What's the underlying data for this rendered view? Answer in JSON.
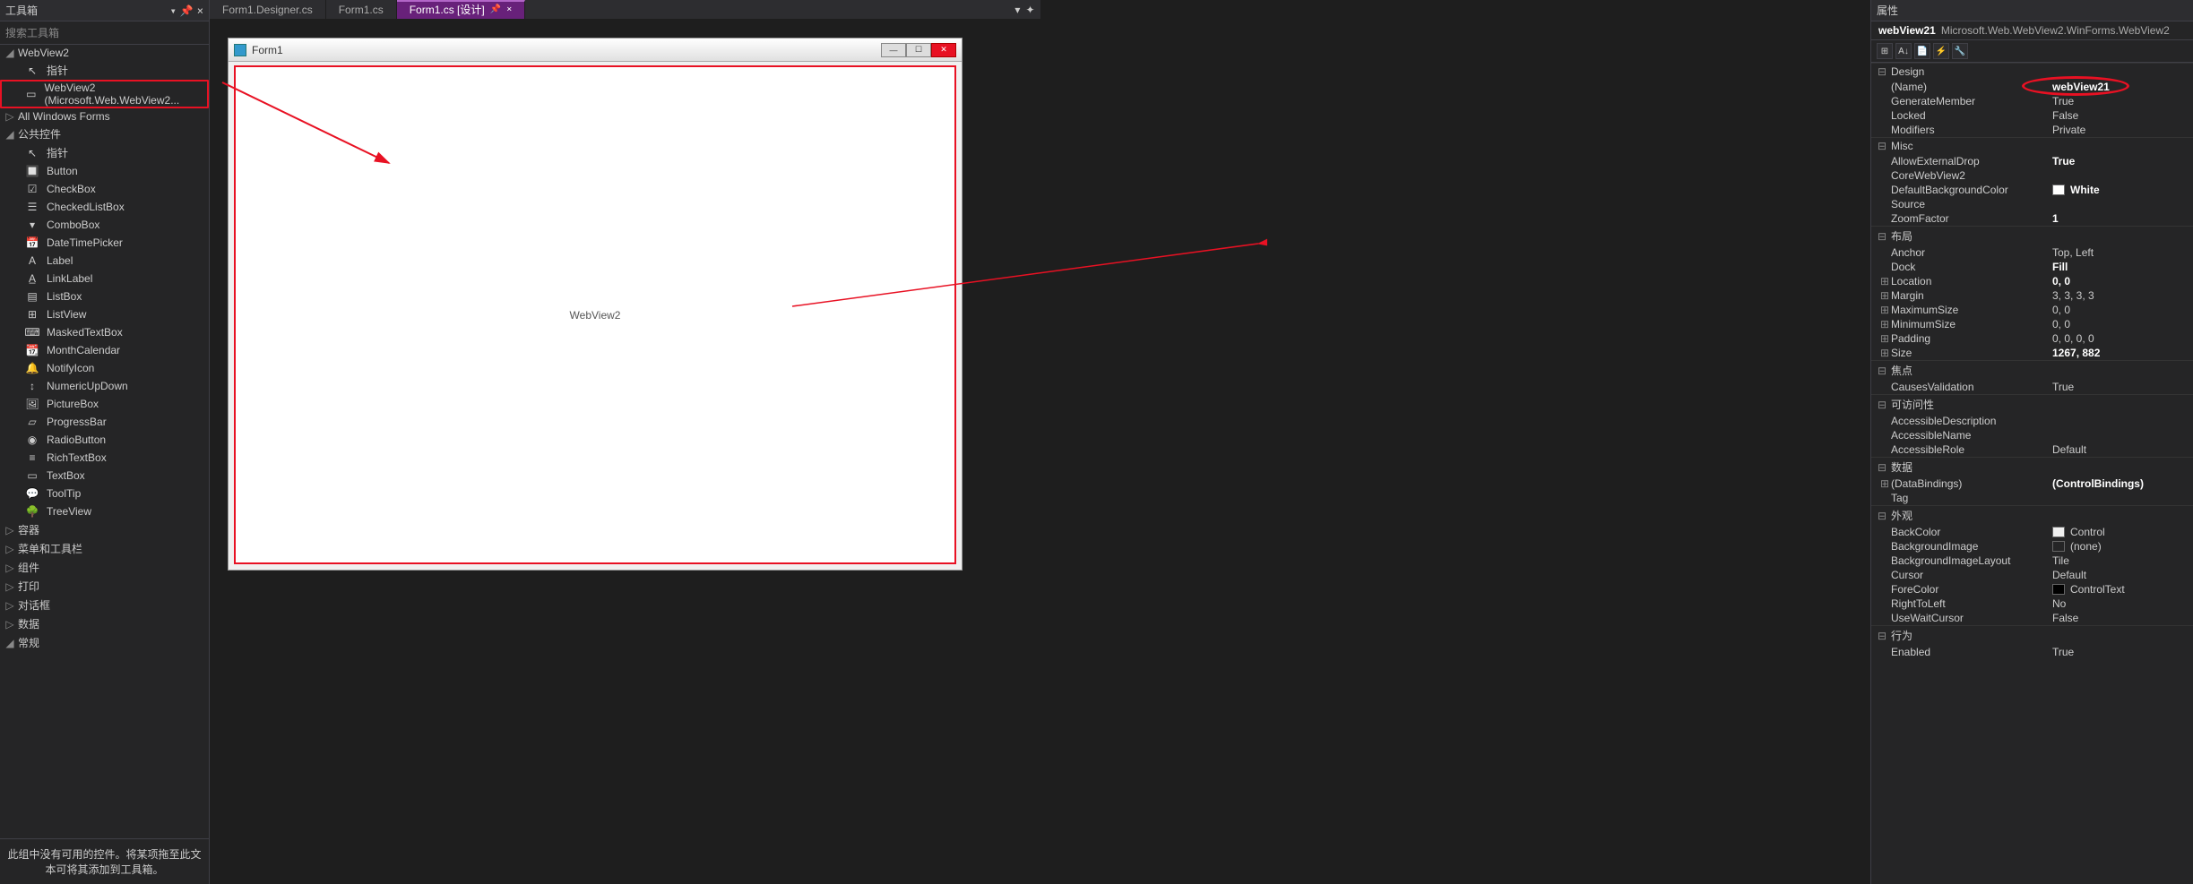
{
  "toolbox": {
    "title": "工具箱",
    "search_placeholder": "搜索工具箱",
    "groups": {
      "webview2": {
        "label": "WebView2",
        "open": true,
        "items": [
          {
            "icon": "pointer",
            "label": "指针"
          },
          {
            "icon": "webview",
            "label": "WebView2 (Microsoft.Web.WebView2...",
            "highlighted": true
          }
        ]
      },
      "allwin": {
        "label": "All Windows Forms",
        "open": false
      },
      "common": {
        "label": "公共控件",
        "open": true
      },
      "containers": {
        "label": "容器",
        "open": false
      },
      "menus": {
        "label": "菜单和工具栏",
        "open": false
      },
      "components": {
        "label": "组件",
        "open": false
      },
      "printing": {
        "label": "打印",
        "open": false
      },
      "dialogs": {
        "label": "对话框",
        "open": false
      },
      "data": {
        "label": "数据",
        "open": false
      },
      "general": {
        "label": "常规",
        "open": true
      }
    },
    "common_items": [
      {
        "icon": "pointer",
        "label": "指针"
      },
      {
        "icon": "button",
        "label": "Button"
      },
      {
        "icon": "checkbox",
        "label": "CheckBox"
      },
      {
        "icon": "clist",
        "label": "CheckedListBox"
      },
      {
        "icon": "combo",
        "label": "ComboBox"
      },
      {
        "icon": "dtp",
        "label": "DateTimePicker"
      },
      {
        "icon": "label",
        "label": "Label"
      },
      {
        "icon": "linklabel",
        "label": "LinkLabel"
      },
      {
        "icon": "listbox",
        "label": "ListBox"
      },
      {
        "icon": "listview",
        "label": "ListView"
      },
      {
        "icon": "mtext",
        "label": "MaskedTextBox"
      },
      {
        "icon": "mcal",
        "label": "MonthCalendar"
      },
      {
        "icon": "nicon",
        "label": "NotifyIcon"
      },
      {
        "icon": "nud",
        "label": "NumericUpDown"
      },
      {
        "icon": "pbox",
        "label": "PictureBox"
      },
      {
        "icon": "pbar",
        "label": "ProgressBar"
      },
      {
        "icon": "radio",
        "label": "RadioButton"
      },
      {
        "icon": "rtb",
        "label": "RichTextBox"
      },
      {
        "icon": "tbox",
        "label": "TextBox"
      },
      {
        "icon": "ttip",
        "label": "ToolTip"
      },
      {
        "icon": "tview",
        "label": "TreeView"
      }
    ],
    "footer": "此组中没有可用的控件。将某项拖至此文本可将其添加到工具箱。"
  },
  "tabs": [
    {
      "label": "Form1.Designer.cs",
      "active": false
    },
    {
      "label": "Form1.cs",
      "active": false
    },
    {
      "label": "Form1.cs [设计]",
      "active": true
    }
  ],
  "designer": {
    "form_title": "Form1",
    "placeholder": "WebView2"
  },
  "properties": {
    "title": "属性",
    "object_name": "webView21",
    "object_type": "Microsoft.Web.WebView2.WinForms.WebView2",
    "cats": [
      {
        "name": "Design",
        "rows": [
          {
            "k": "(Name)",
            "v": "webView21",
            "bold": true,
            "circled": true
          },
          {
            "k": "GenerateMember",
            "v": "True"
          },
          {
            "k": "Locked",
            "v": "False"
          },
          {
            "k": "Modifiers",
            "v": "Private"
          }
        ]
      },
      {
        "name": "Misc",
        "rows": [
          {
            "k": "AllowExternalDrop",
            "v": "True",
            "bold": true
          },
          {
            "k": "CoreWebView2",
            "v": ""
          },
          {
            "k": "DefaultBackgroundColor",
            "v": "White",
            "bold": true,
            "swatch": "#ffffff"
          },
          {
            "k": "Source",
            "v": ""
          },
          {
            "k": "ZoomFactor",
            "v": "1",
            "bold": true
          }
        ]
      },
      {
        "name": "布局",
        "rows": [
          {
            "k": "Anchor",
            "v": "Top, Left"
          },
          {
            "k": "Dock",
            "v": "Fill",
            "bold": true
          },
          {
            "k": "Location",
            "v": "0, 0",
            "bold": true,
            "expandable": true
          },
          {
            "k": "Margin",
            "v": "3, 3, 3, 3",
            "expandable": true
          },
          {
            "k": "MaximumSize",
            "v": "0, 0",
            "expandable": true
          },
          {
            "k": "MinimumSize",
            "v": "0, 0",
            "expandable": true
          },
          {
            "k": "Padding",
            "v": "0, 0, 0, 0",
            "expandable": true
          },
          {
            "k": "Size",
            "v": "1267, 882",
            "bold": true,
            "expandable": true
          }
        ]
      },
      {
        "name": "焦点",
        "rows": [
          {
            "k": "CausesValidation",
            "v": "True"
          }
        ]
      },
      {
        "name": "可访问性",
        "rows": [
          {
            "k": "AccessibleDescription",
            "v": ""
          },
          {
            "k": "AccessibleName",
            "v": ""
          },
          {
            "k": "AccessibleRole",
            "v": "Default"
          }
        ]
      },
      {
        "name": "数据",
        "rows": [
          {
            "k": "(DataBindings)",
            "v": "(ControlBindings)",
            "bold": true,
            "expandable": true
          },
          {
            "k": "Tag",
            "v": ""
          }
        ]
      },
      {
        "name": "外观",
        "rows": [
          {
            "k": "BackColor",
            "v": "Control",
            "swatch": "#f0f0f0"
          },
          {
            "k": "BackgroundImage",
            "v": "(none)",
            "swatch": "transparent"
          },
          {
            "k": "BackgroundImageLayout",
            "v": "Tile"
          },
          {
            "k": "Cursor",
            "v": "Default"
          },
          {
            "k": "ForeColor",
            "v": "ControlText",
            "swatch": "#000000"
          },
          {
            "k": "RightToLeft",
            "v": "No"
          },
          {
            "k": "UseWaitCursor",
            "v": "False"
          }
        ]
      },
      {
        "name": "行为",
        "rows": [
          {
            "k": "Enabled",
            "v": "True"
          }
        ]
      }
    ]
  }
}
